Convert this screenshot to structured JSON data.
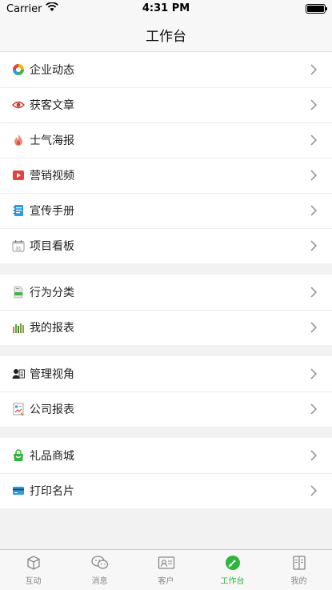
{
  "status": {
    "carrier": "Carrier",
    "time": "4:31 PM"
  },
  "nav": {
    "title": "工作台"
  },
  "groups": [
    {
      "items": [
        {
          "label": "企业动态",
          "icon": "pinwheel-icon"
        },
        {
          "label": "获客文章",
          "icon": "eye-icon"
        },
        {
          "label": "士气海报",
          "icon": "flame-icon"
        },
        {
          "label": "营销视频",
          "icon": "play-icon"
        },
        {
          "label": "宣传手册",
          "icon": "notebook-icon"
        },
        {
          "label": "项目看板",
          "icon": "calendar-icon"
        }
      ]
    },
    {
      "items": [
        {
          "label": "行为分类",
          "icon": "document-icon"
        },
        {
          "label": "我的报表",
          "icon": "bar-chart-icon"
        }
      ]
    },
    {
      "items": [
        {
          "label": "管理视角",
          "icon": "person-card-icon"
        },
        {
          "label": "公司报表",
          "icon": "report-icon"
        }
      ]
    },
    {
      "items": [
        {
          "label": "礼品商城",
          "icon": "shopping-bag-icon"
        },
        {
          "label": "打印名片",
          "icon": "card-icon"
        }
      ]
    }
  ],
  "calendar_day": "31",
  "tabs": [
    {
      "label": "互动",
      "icon": "cube-icon",
      "active": false
    },
    {
      "label": "消息",
      "icon": "chat-icon",
      "active": false
    },
    {
      "label": "客户",
      "icon": "contact-card-icon",
      "active": false
    },
    {
      "label": "工作台",
      "icon": "workbench-icon",
      "active": true
    },
    {
      "label": "我的",
      "icon": "profile-book-icon",
      "active": false
    }
  ],
  "colors": {
    "accent": "#2db63a",
    "play": "#e94040",
    "notebook": "#2e9be6",
    "bag": "#2db63a",
    "card": "#2e9be6"
  }
}
